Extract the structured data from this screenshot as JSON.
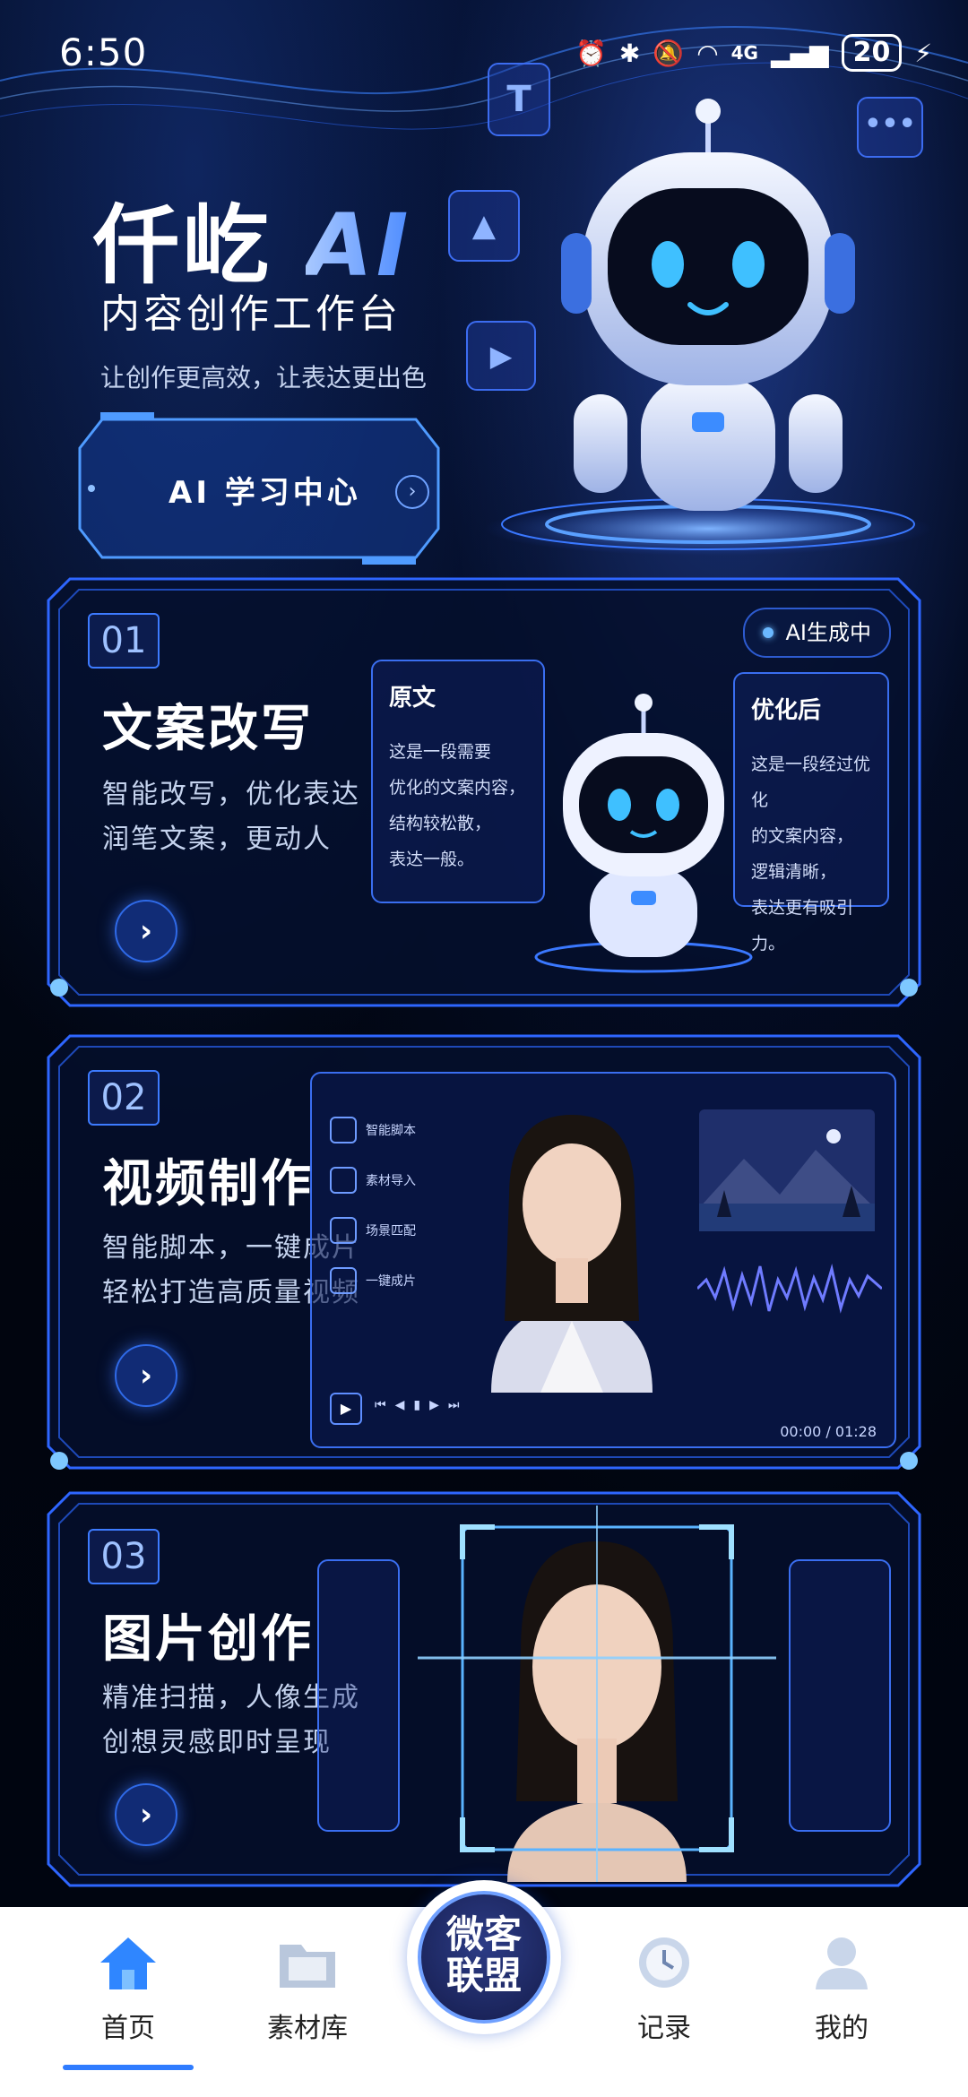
{
  "status_bar": {
    "time": "6:50",
    "network": "4G",
    "battery": "20",
    "icons": [
      "alarm-icon",
      "bluetooth-icon",
      "mute-icon",
      "wifi-icon",
      "signal-icon",
      "charging-icon"
    ]
  },
  "hero": {
    "brand_cn": "仟屹",
    "brand_ai": "AI",
    "subtitle": "内容创作工作台",
    "slogan": "让创作更高效，让表达更出色",
    "learn_button": "AI 学习中心",
    "float_icons": [
      "text-icon",
      "image-icon",
      "video-icon",
      "chat-icon"
    ]
  },
  "cards": [
    {
      "num": "01",
      "title": "文案改写",
      "desc1": "智能改写，优化表达",
      "desc2": "润笔文案，更动人",
      "badge": "AI生成中",
      "original": {
        "heading": "原文",
        "lines": [
          "这是一段需要",
          "优化的文案内容，",
          "结构较松散，",
          "表达一般。"
        ]
      },
      "optimized": {
        "heading": "优化后",
        "lines": [
          "这是一段经过优化",
          "的文案内容，",
          "逻辑清晰，",
          "表达更有吸引力。"
        ]
      }
    },
    {
      "num": "02",
      "title": "视频制作",
      "desc1": "智能脚本，一键成片",
      "desc2": "轻松打造高质量视频",
      "menu": [
        "智能脚本",
        "素材导入",
        "场景匹配",
        "一键成片"
      ],
      "timecode": "00:00 / 01:28"
    },
    {
      "num": "03",
      "title": "图片创作",
      "desc1": "精准扫描，人像生成",
      "desc2": "创想灵感即时呈现"
    }
  ],
  "nav": {
    "items": [
      {
        "label": "首页",
        "icon": "home-icon",
        "active": true
      },
      {
        "label": "素材库",
        "icon": "folder-icon"
      },
      {
        "label": "记录",
        "icon": "clock-icon"
      },
      {
        "label": "我的",
        "icon": "user-icon"
      }
    ],
    "center_line1": "微客",
    "center_line2": "联盟"
  },
  "colors": {
    "accent": "#2f7cff",
    "background": "#01050f",
    "glow": "#4e8cff"
  }
}
